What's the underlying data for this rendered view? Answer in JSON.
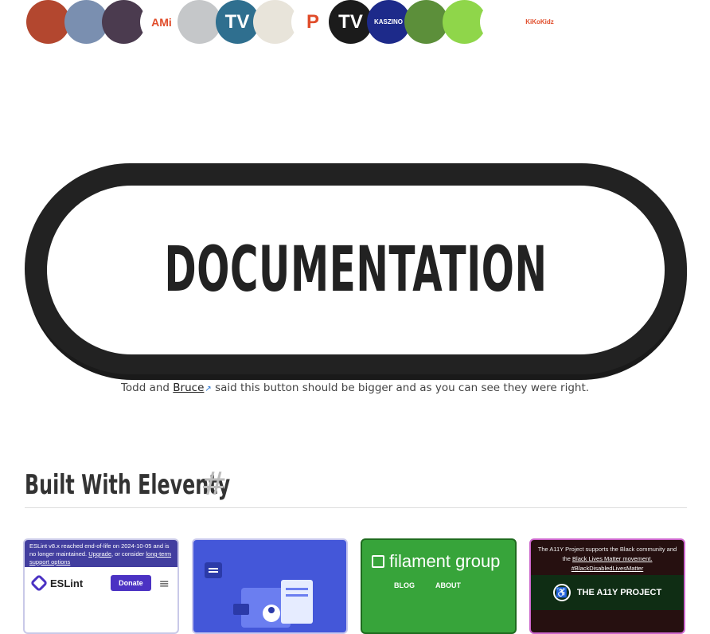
{
  "avatars": [
    {
      "name": "avatar-woman-red",
      "bg": "#b3472f",
      "glyph": ""
    },
    {
      "name": "avatar-man-sunglasses",
      "bg": "#7a8fb0",
      "glyph": ""
    },
    {
      "name": "avatar-dark-hair",
      "bg": "#4b3b4f",
      "glyph": ""
    },
    {
      "name": "avatar-ami-logo",
      "bg": "#ffffff",
      "glyph": "AMi"
    },
    {
      "name": "avatar-man-glasses",
      "bg": "#c5c7c9",
      "glyph": ""
    },
    {
      "name": "avatar-tv-logo",
      "bg": "#2f6f8f",
      "glyph": "TV"
    },
    {
      "name": "avatar-pattern",
      "bg": "#e8e4da",
      "glyph": ""
    },
    {
      "name": "avatar-pocket-logo",
      "bg": "#ffffff",
      "glyph": "P"
    },
    {
      "name": "avatar-tv-orange",
      "bg": "#1b1b1b",
      "glyph": "TV"
    },
    {
      "name": "avatar-kaszino",
      "bg": "#1d2a8a",
      "glyph": "KASZINO"
    },
    {
      "name": "avatar-man-green",
      "bg": "#5c8f3a",
      "glyph": ""
    },
    {
      "name": "avatar-green-blob",
      "bg": "#8fd64a",
      "glyph": ""
    },
    {
      "name": "avatar-road",
      "bg": "#ffffff",
      "glyph": ""
    },
    {
      "name": "avatar-kikokidz",
      "bg": "#ffffff",
      "glyph": "KiKoKidz"
    }
  ],
  "documentation": {
    "label": "DOCUMENTATION"
  },
  "caption": {
    "prefix": "Todd and ",
    "link": "Bruce",
    "suffix": " said this button should be bigger and as you can see they were right."
  },
  "section": {
    "title": "Built With Eleventy",
    "anchor": "#"
  },
  "cards": {
    "eslint": {
      "banner_pre": "ESLint v8.x reached end-of-life on 2024-10-05 and is no longer maintained.",
      "banner_upgrade": "Upgrade",
      "banner_mid": ", or consider",
      "banner_lts": "long-term support options",
      "name": "ESLint",
      "donate": "Donate"
    },
    "filament": {
      "name": "filament group",
      "nav": [
        "BLOG",
        "ABOUT"
      ]
    },
    "a11y": {
      "banner_pre": "The A11Y Project supports the Black community and the",
      "banner_link": "Black Lives Matter movement.",
      "banner_tag": "#BlackDisabledLivesMatter",
      "name": "THE A11Y PROJECT"
    }
  },
  "colors": {
    "accent": "#222222",
    "link_icon": "#2a77d4"
  }
}
